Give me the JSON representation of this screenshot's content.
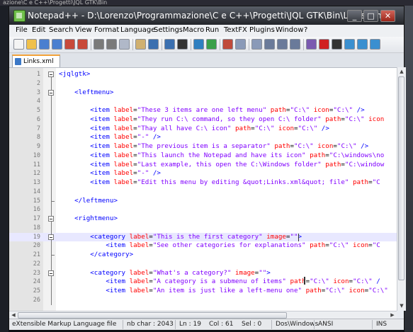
{
  "background": {
    "title_fragment": "azione\\C e C++\\Progetti\\JQL GTK\\Bin"
  },
  "window": {
    "title": "Notepad++ - D:\\Lorenzo\\Programmazione\\C e C++\\Progetti\\JQL GTK\\Bin\\Links.xml",
    "buttons": {
      "minimize": "_",
      "maximize": "□",
      "close": "✕"
    }
  },
  "menu": [
    "File",
    "Edit",
    "Search",
    "View",
    "Format",
    "Language",
    "Settings",
    "Macro",
    "Run",
    "TextFX",
    "Plugins",
    "Window",
    "?"
  ],
  "toolbar_icons": [
    "new-file-icon",
    "open-file-icon",
    "save-icon",
    "save-all-icon",
    "close-icon",
    "close-all-icon",
    "print-icon",
    "cut-icon",
    "copy-icon",
    "paste-icon",
    "undo-icon",
    "redo-icon",
    "find-icon",
    "replace-icon",
    "zoom-in-icon",
    "zoom-out-icon",
    "sync-v-icon",
    "sync-h-icon",
    "wrap-icon",
    "all-chars-icon",
    "indent-guide-icon",
    "user-lang-icon",
    "macro-record-icon",
    "macro-stop-icon",
    "macro-play-icon",
    "macro-run-multiple-icon",
    "macro-save-icon"
  ],
  "tabs": [
    {
      "label": "Links.xml"
    }
  ],
  "editor": {
    "current_line": 19,
    "lines": [
      {
        "n": "1",
        "fold": "box",
        "indent": 0,
        "tokens": [
          [
            "tag",
            "<jqlgtk>"
          ]
        ]
      },
      {
        "n": "2",
        "fold": "line",
        "indent": 0,
        "tokens": []
      },
      {
        "n": "3",
        "fold": "box",
        "indent": 4,
        "tokens": [
          [
            "tag",
            "<leftmenu>"
          ]
        ]
      },
      {
        "n": "4",
        "fold": "line",
        "indent": 0,
        "tokens": []
      },
      {
        "n": "5",
        "fold": "line",
        "indent": 8,
        "tokens": [
          [
            "tag",
            "<item "
          ],
          [
            "attr",
            "label"
          ],
          [
            "eq",
            "="
          ],
          [
            "val",
            "\"These 3 items are one left menu\""
          ],
          [
            "tag",
            " "
          ],
          [
            "attr",
            "path"
          ],
          [
            "eq",
            "="
          ],
          [
            "val",
            "\"C:\\\""
          ],
          [
            "tag",
            " "
          ],
          [
            "attr",
            "icon"
          ],
          [
            "eq",
            "="
          ],
          [
            "val",
            "\"C:\\\""
          ],
          [
            "tag",
            " />"
          ]
        ]
      },
      {
        "n": "6",
        "fold": "line",
        "indent": 8,
        "tokens": [
          [
            "tag",
            "<item "
          ],
          [
            "attr",
            "label"
          ],
          [
            "eq",
            "="
          ],
          [
            "val",
            "\"They run C:\\ command, so they open C:\\ folder\""
          ],
          [
            "tag",
            " "
          ],
          [
            "attr",
            "path"
          ],
          [
            "eq",
            "="
          ],
          [
            "val",
            "\"C:\\\""
          ],
          [
            "tag",
            " "
          ],
          [
            "attr",
            "icon"
          ]
        ]
      },
      {
        "n": "7",
        "fold": "line",
        "indent": 8,
        "tokens": [
          [
            "tag",
            "<item "
          ],
          [
            "attr",
            "label"
          ],
          [
            "eq",
            "="
          ],
          [
            "val",
            "\"Thay all have C:\\ icon\""
          ],
          [
            "tag",
            " "
          ],
          [
            "attr",
            "path"
          ],
          [
            "eq",
            "="
          ],
          [
            "val",
            "\"C:\\\""
          ],
          [
            "tag",
            " "
          ],
          [
            "attr",
            "icon"
          ],
          [
            "eq",
            "="
          ],
          [
            "val",
            "\"C:\\\""
          ],
          [
            "tag",
            " />"
          ]
        ]
      },
      {
        "n": "8",
        "fold": "line",
        "indent": 8,
        "tokens": [
          [
            "tag",
            "<item "
          ],
          [
            "attr",
            "label"
          ],
          [
            "eq",
            "="
          ],
          [
            "val",
            "\"-\""
          ],
          [
            "tag",
            " />"
          ]
        ]
      },
      {
        "n": "9",
        "fold": "line",
        "indent": 8,
        "tokens": [
          [
            "tag",
            "<item "
          ],
          [
            "attr",
            "label"
          ],
          [
            "eq",
            "="
          ],
          [
            "val",
            "\"The previous item is a separator\""
          ],
          [
            "tag",
            " "
          ],
          [
            "attr",
            "path"
          ],
          [
            "eq",
            "="
          ],
          [
            "val",
            "\"C:\\\""
          ],
          [
            "tag",
            " "
          ],
          [
            "attr",
            "icon"
          ],
          [
            "eq",
            "="
          ],
          [
            "val",
            "\"C:\\\""
          ],
          [
            "tag",
            " />"
          ]
        ]
      },
      {
        "n": "10",
        "fold": "line",
        "indent": 8,
        "tokens": [
          [
            "tag",
            "<item "
          ],
          [
            "attr",
            "label"
          ],
          [
            "eq",
            "="
          ],
          [
            "val",
            "\"This launch the Notepad and have its icon\""
          ],
          [
            "tag",
            " "
          ],
          [
            "attr",
            "path"
          ],
          [
            "eq",
            "="
          ],
          [
            "val",
            "\"C:\\windows\\no"
          ]
        ]
      },
      {
        "n": "11",
        "fold": "line",
        "indent": 8,
        "tokens": [
          [
            "tag",
            "<item "
          ],
          [
            "attr",
            "label"
          ],
          [
            "eq",
            "="
          ],
          [
            "val",
            "\"Last example, this open the C:\\Windows folder\""
          ],
          [
            "tag",
            " "
          ],
          [
            "attr",
            "path"
          ],
          [
            "eq",
            "="
          ],
          [
            "val",
            "\"C:\\window"
          ]
        ]
      },
      {
        "n": "12",
        "fold": "line",
        "indent": 8,
        "tokens": [
          [
            "tag",
            "<item "
          ],
          [
            "attr",
            "label"
          ],
          [
            "eq",
            "="
          ],
          [
            "val",
            "\"-\""
          ],
          [
            "tag",
            " />"
          ]
        ]
      },
      {
        "n": "13",
        "fold": "line",
        "indent": 8,
        "tokens": [
          [
            "tag",
            "<item "
          ],
          [
            "attr",
            "label"
          ],
          [
            "eq",
            "="
          ],
          [
            "val",
            "\"Edit this menu by editing &quot;Links.xml&quot; file\""
          ],
          [
            "tag",
            " "
          ],
          [
            "attr",
            "path"
          ],
          [
            "eq",
            "="
          ],
          [
            "val",
            "\"C"
          ]
        ]
      },
      {
        "n": "14",
        "fold": "line",
        "indent": 0,
        "tokens": []
      },
      {
        "n": "15",
        "fold": "end",
        "indent": 4,
        "tokens": [
          [
            "tag",
            "</leftmenu>"
          ]
        ]
      },
      {
        "n": "16",
        "fold": "line",
        "indent": 0,
        "tokens": []
      },
      {
        "n": "17",
        "fold": "box",
        "indent": 4,
        "tokens": [
          [
            "tag",
            "<rightmenu>"
          ]
        ]
      },
      {
        "n": "18",
        "fold": "line",
        "indent": 0,
        "tokens": []
      },
      {
        "n": "19",
        "fold": "box",
        "indent": 8,
        "tokens": [
          [
            "tag",
            "<category "
          ],
          [
            "attr",
            "label"
          ],
          [
            "eq",
            "="
          ],
          [
            "val",
            "\"This is the first category\""
          ],
          [
            "tag",
            " "
          ],
          [
            "attr",
            "image"
          ],
          [
            "eq",
            "="
          ],
          [
            "val",
            "\"\""
          ],
          [
            "tag",
            ">"
          ]
        ]
      },
      {
        "n": "20",
        "fold": "line",
        "indent": 12,
        "tokens": [
          [
            "tag",
            "<item "
          ],
          [
            "attr",
            "label"
          ],
          [
            "eq",
            "="
          ],
          [
            "val",
            "\"See other categories for explanations\""
          ],
          [
            "tag",
            " "
          ],
          [
            "attr",
            "path"
          ],
          [
            "eq",
            "="
          ],
          [
            "val",
            "\"C:\\\""
          ],
          [
            "tag",
            " "
          ],
          [
            "attr",
            "icon"
          ],
          [
            "eq",
            "="
          ],
          [
            "val",
            "\"C"
          ]
        ]
      },
      {
        "n": "21",
        "fold": "end",
        "indent": 8,
        "tokens": [
          [
            "tag",
            "</category>"
          ]
        ]
      },
      {
        "n": "22",
        "fold": "line",
        "indent": 0,
        "tokens": []
      },
      {
        "n": "23",
        "fold": "box",
        "indent": 8,
        "tokens": [
          [
            "tag",
            "<category "
          ],
          [
            "attr",
            "label"
          ],
          [
            "eq",
            "="
          ],
          [
            "val",
            "\"What's a category?\""
          ],
          [
            "tag",
            " "
          ],
          [
            "attr",
            "image"
          ],
          [
            "eq",
            "="
          ],
          [
            "val",
            "\"\""
          ],
          [
            "tag",
            ">"
          ]
        ]
      },
      {
        "n": "24",
        "fold": "line",
        "indent": 12,
        "tokens": [
          [
            "tag",
            "<item "
          ],
          [
            "attr",
            "label"
          ],
          [
            "eq",
            "="
          ],
          [
            "val",
            "\"A category is a submenu of items\""
          ],
          [
            "tag",
            " "
          ],
          [
            "attr",
            "path"
          ],
          [
            "eq",
            "="
          ],
          [
            "val",
            "\"C:\\\""
          ],
          [
            "tag",
            " "
          ],
          [
            "attr",
            "icon"
          ],
          [
            "eq",
            "="
          ],
          [
            "val",
            "\"C:\\\""
          ],
          [
            "tag",
            " /"
          ]
        ]
      },
      {
        "n": "25",
        "fold": "line",
        "indent": 12,
        "tokens": [
          [
            "tag",
            "<item "
          ],
          [
            "attr",
            "label"
          ],
          [
            "eq",
            "="
          ],
          [
            "val",
            "\"An item is just like a left-menu one\""
          ],
          [
            "tag",
            " "
          ],
          [
            "attr",
            "path"
          ],
          [
            "eq",
            "="
          ],
          [
            "val",
            "\"C:\\\""
          ],
          [
            "tag",
            " "
          ],
          [
            "attr",
            "icon"
          ],
          [
            "eq",
            "="
          ],
          [
            "val",
            "\"C:\\\""
          ]
        ]
      },
      {
        "n": "26",
        "fold": "line",
        "indent": 12,
        "tokens": []
      }
    ]
  },
  "statusbar": {
    "language": "eXtensible Markup Language file",
    "nb_char": "nb char : 2043",
    "line": "Ln : 19",
    "col": "Col : 61",
    "sel": "Sel : 0",
    "eol": "Dos\\Windows",
    "encoding": "ANSI",
    "mode": "INS"
  },
  "colors": {
    "tag": "#0000ff",
    "attr": "#ff0000",
    "value": "#8000ff",
    "current_line": "#e8e8ff"
  }
}
